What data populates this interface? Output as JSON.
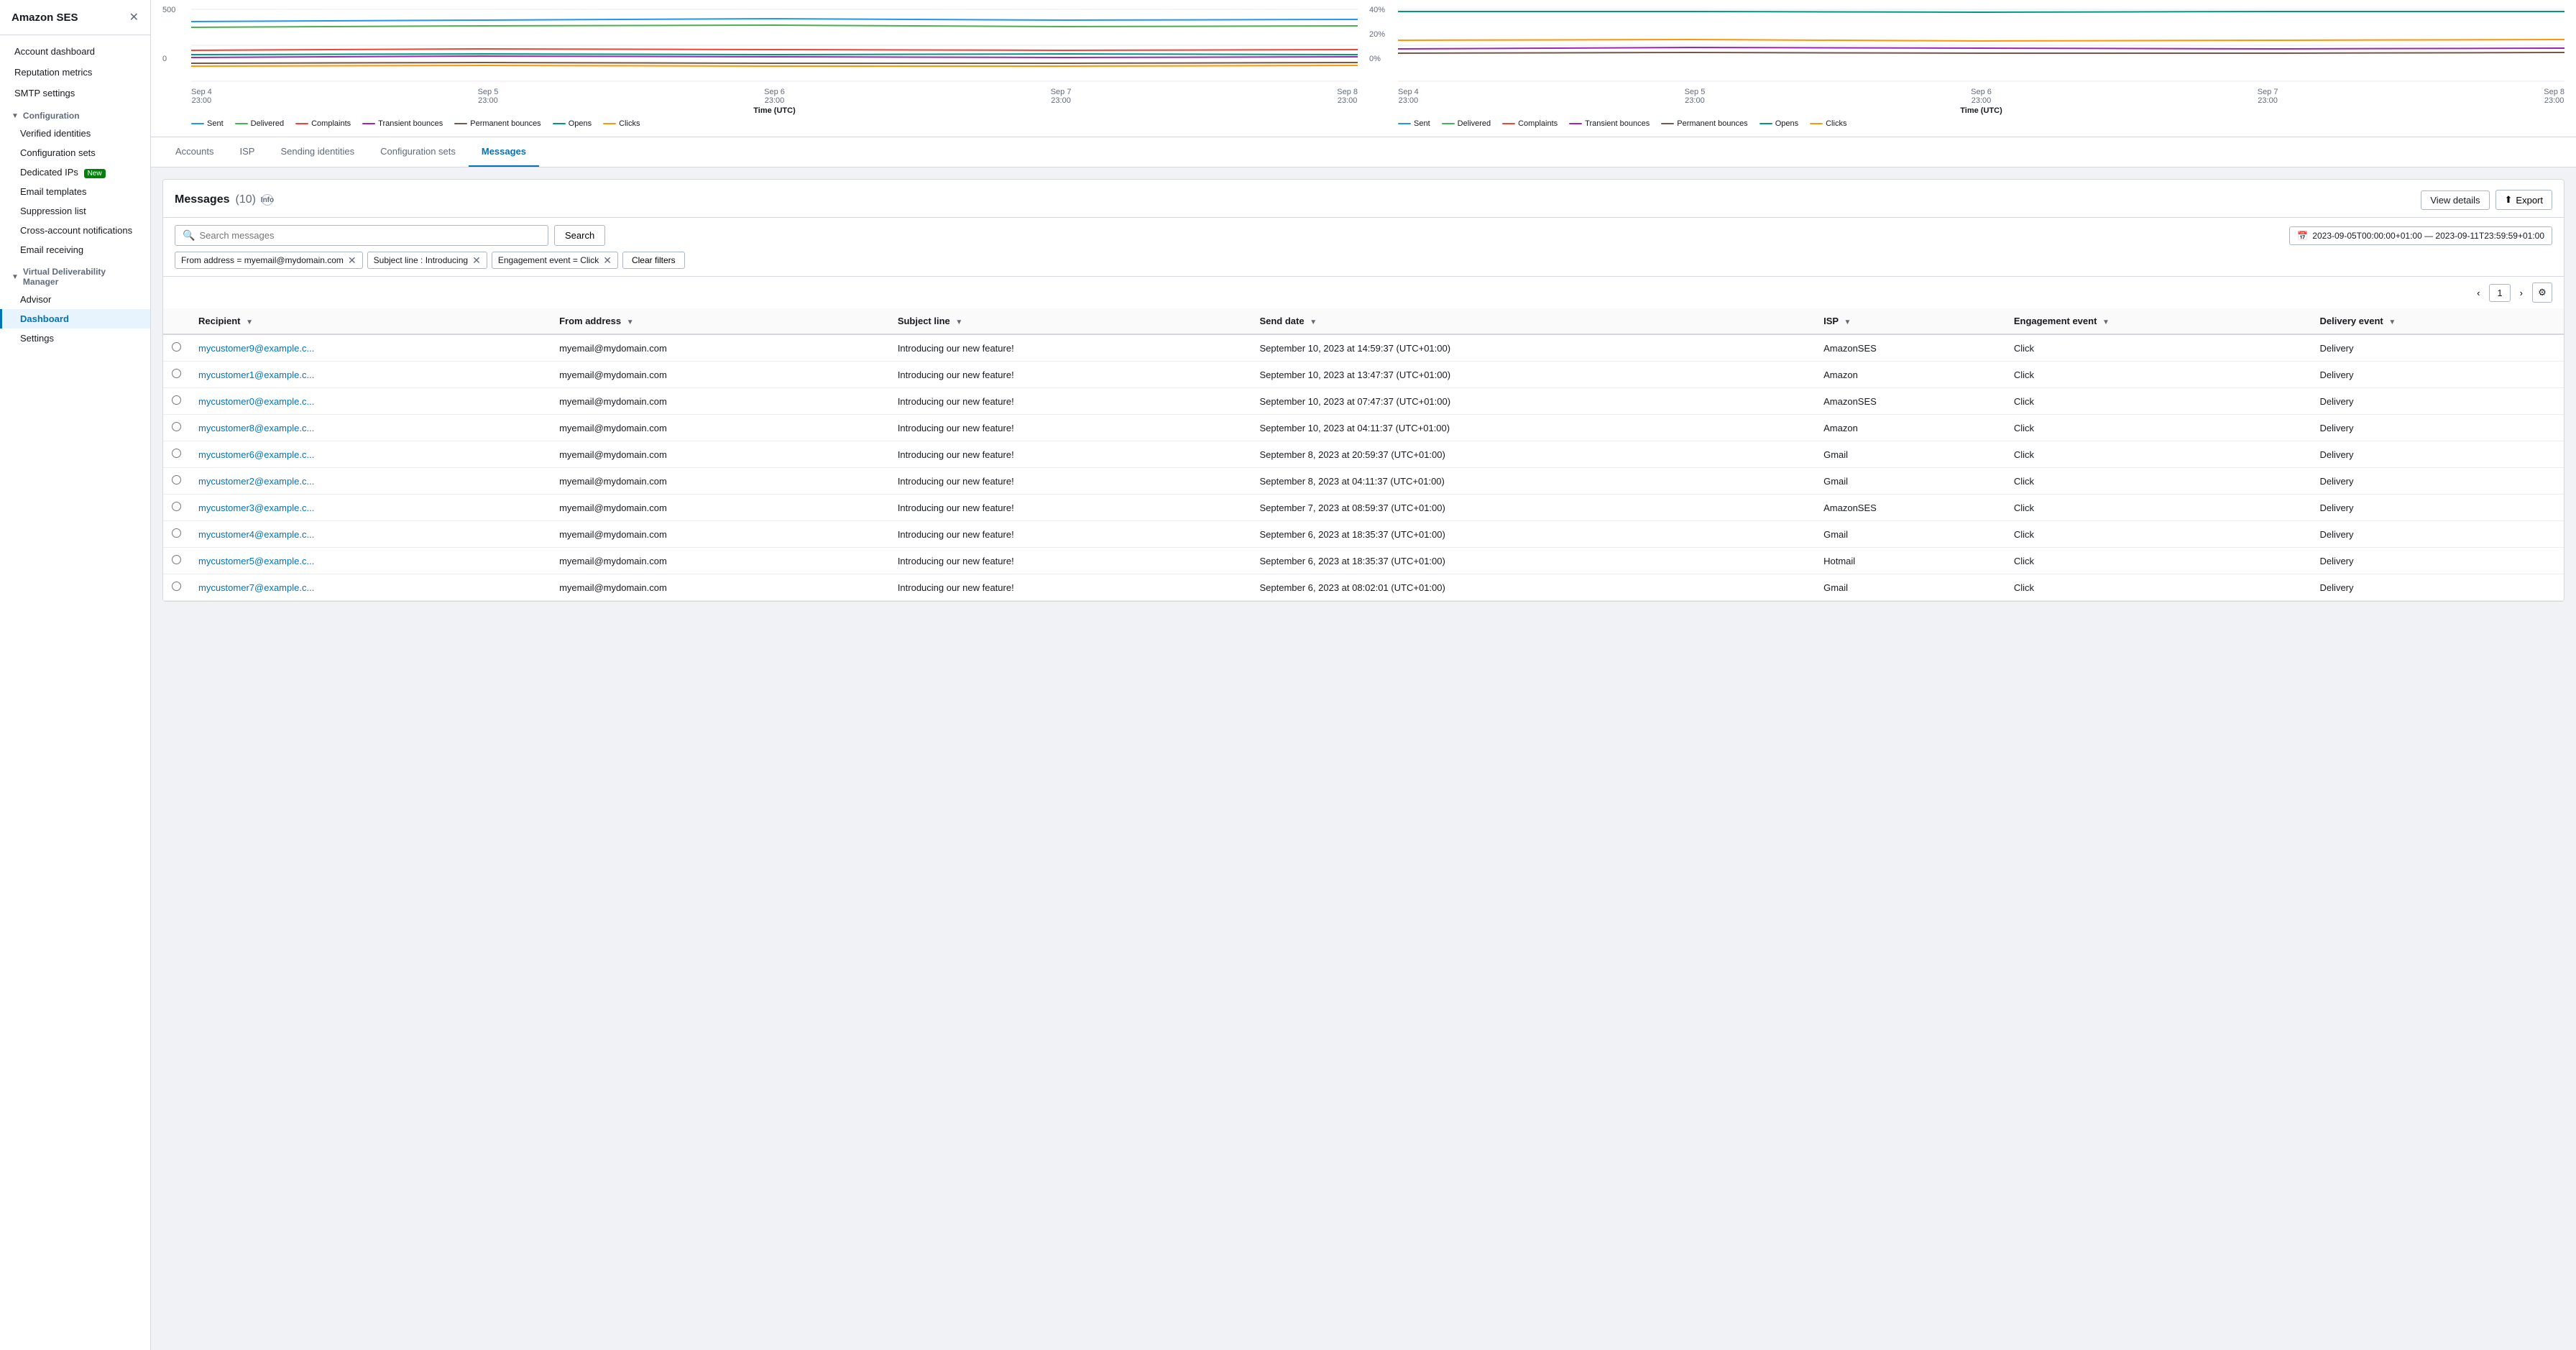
{
  "app": {
    "title": "Amazon SES",
    "close_icon": "✕"
  },
  "sidebar": {
    "nav_items": [
      {
        "id": "account-dashboard",
        "label": "Account dashboard",
        "type": "item"
      },
      {
        "id": "reputation-metrics",
        "label": "Reputation metrics",
        "type": "item"
      },
      {
        "id": "smtp-settings",
        "label": "SMTP settings",
        "type": "item"
      }
    ],
    "sections": [
      {
        "id": "configuration",
        "label": "Configuration",
        "arrow": "▼",
        "children": [
          {
            "id": "verified-identities",
            "label": "Verified identities"
          },
          {
            "id": "configuration-sets",
            "label": "Configuration sets"
          },
          {
            "id": "dedicated-ips",
            "label": "Dedicated IPs",
            "badge": "New"
          },
          {
            "id": "email-templates",
            "label": "Email templates"
          },
          {
            "id": "suppression-list",
            "label": "Suppression list"
          },
          {
            "id": "cross-account",
            "label": "Cross-account notifications"
          },
          {
            "id": "email-receiving",
            "label": "Email receiving"
          }
        ]
      },
      {
        "id": "vdm",
        "label": "Virtual Deliverability Manager",
        "arrow": "▼",
        "children": [
          {
            "id": "advisor",
            "label": "Advisor"
          },
          {
            "id": "dashboard",
            "label": "Dashboard",
            "active": true
          },
          {
            "id": "settings",
            "label": "Settings"
          }
        ]
      }
    ]
  },
  "charts": {
    "left": {
      "y_labels": [
        "500",
        "",
        "0"
      ],
      "x_labels": [
        {
          "date": "Sep 4",
          "time": "23:00"
        },
        {
          "date": "Sep 5",
          "time": "23:00"
        },
        {
          "date": "Sep 6",
          "time": "23:00"
        },
        {
          "date": "Sep 7",
          "time": "23:00"
        },
        {
          "date": "Sep 8",
          "time": "23:00"
        }
      ],
      "x_title": "Time (UTC)",
      "legend": [
        {
          "label": "Sent",
          "color": "#2196f3"
        },
        {
          "label": "Delivered",
          "color": "#4caf50"
        },
        {
          "label": "Complaints",
          "color": "#f44336"
        },
        {
          "label": "Transient bounces",
          "color": "#9c27b0"
        },
        {
          "label": "Permanent bounces",
          "color": "#795548"
        },
        {
          "label": "Opens",
          "color": "#009688"
        },
        {
          "label": "Clicks",
          "color": "#ff9800"
        }
      ]
    },
    "right": {
      "y_labels": [
        "40%",
        "20%",
        "0%"
      ],
      "x_labels": [
        {
          "date": "Sep 4",
          "time": "23:00"
        },
        {
          "date": "Sep 5",
          "time": "23:00"
        },
        {
          "date": "Sep 6",
          "time": "23:00"
        },
        {
          "date": "Sep 7",
          "time": "23:00"
        },
        {
          "date": "Sep 8",
          "time": "23:00"
        }
      ],
      "x_title": "Time (UTC)",
      "legend": [
        {
          "label": "Sent",
          "color": "#2196f3"
        },
        {
          "label": "Delivered",
          "color": "#4caf50"
        },
        {
          "label": "Complaints",
          "color": "#f44336"
        },
        {
          "label": "Transient bounces",
          "color": "#9c27b0"
        },
        {
          "label": "Permanent bounces",
          "color": "#795548"
        },
        {
          "label": "Opens",
          "color": "#009688"
        },
        {
          "label": "Clicks",
          "color": "#ff9800"
        }
      ]
    }
  },
  "tabs": [
    {
      "id": "accounts",
      "label": "Accounts"
    },
    {
      "id": "isp",
      "label": "ISP"
    },
    {
      "id": "sending-identities",
      "label": "Sending identities"
    },
    {
      "id": "configuration-sets",
      "label": "Configuration sets"
    },
    {
      "id": "messages",
      "label": "Messages",
      "active": true
    }
  ],
  "messages": {
    "title": "Messages",
    "count": "(10)",
    "info_label": "Info",
    "view_details_label": "View details",
    "export_label": "Export",
    "export_icon": "⬆",
    "search_placeholder": "Search messages",
    "search_label": "Search",
    "date_range": "2023-09-05T00:00:00+01:00 — 2023-09-11T23:59:59+01:00",
    "calendar_icon": "📅",
    "filters": [
      {
        "id": "from-address",
        "label": "From address = myemail@mydomain.com"
      },
      {
        "id": "subject-line",
        "label": "Subject line : Introducing"
      },
      {
        "id": "engagement-event",
        "label": "Engagement event = Click"
      }
    ],
    "clear_filters_label": "Clear filters",
    "page_current": "1",
    "columns": [
      {
        "id": "select",
        "label": ""
      },
      {
        "id": "recipient",
        "label": "Recipient"
      },
      {
        "id": "from-address",
        "label": "From address"
      },
      {
        "id": "subject-line",
        "label": "Subject line"
      },
      {
        "id": "send-date",
        "label": "Send date"
      },
      {
        "id": "isp",
        "label": "ISP"
      },
      {
        "id": "engagement-event",
        "label": "Engagement event"
      },
      {
        "id": "delivery-event",
        "label": "Delivery event"
      }
    ],
    "rows": [
      {
        "recipient": "mycustomer9@example.c...",
        "from_address": "myemail@mydomain.com",
        "subject_line": "Introducing our new feature!",
        "send_date": "September 10, 2023 at 14:59:37 (UTC+01:00)",
        "isp": "AmazonSES",
        "engagement_event": "Click",
        "delivery_event": "Delivery"
      },
      {
        "recipient": "mycustomer1@example.c...",
        "from_address": "myemail@mydomain.com",
        "subject_line": "Introducing our new feature!",
        "send_date": "September 10, 2023 at 13:47:37 (UTC+01:00)",
        "isp": "Amazon",
        "engagement_event": "Click",
        "delivery_event": "Delivery"
      },
      {
        "recipient": "mycustomer0@example.c...",
        "from_address": "myemail@mydomain.com",
        "subject_line": "Introducing our new feature!",
        "send_date": "September 10, 2023 at 07:47:37 (UTC+01:00)",
        "isp": "AmazonSES",
        "engagement_event": "Click",
        "delivery_event": "Delivery"
      },
      {
        "recipient": "mycustomer8@example.c...",
        "from_address": "myemail@mydomain.com",
        "subject_line": "Introducing our new feature!",
        "send_date": "September 10, 2023 at 04:11:37 (UTC+01:00)",
        "isp": "Amazon",
        "engagement_event": "Click",
        "delivery_event": "Delivery"
      },
      {
        "recipient": "mycustomer6@example.c...",
        "from_address": "myemail@mydomain.com",
        "subject_line": "Introducing our new feature!",
        "send_date": "September 8, 2023 at 20:59:37 (UTC+01:00)",
        "isp": "Gmail",
        "engagement_event": "Click",
        "delivery_event": "Delivery"
      },
      {
        "recipient": "mycustomer2@example.c...",
        "from_address": "myemail@mydomain.com",
        "subject_line": "Introducing our new feature!",
        "send_date": "September 8, 2023 at 04:11:37 (UTC+01:00)",
        "isp": "Gmail",
        "engagement_event": "Click",
        "delivery_event": "Delivery"
      },
      {
        "recipient": "mycustomer3@example.c...",
        "from_address": "myemail@mydomain.com",
        "subject_line": "Introducing our new feature!",
        "send_date": "September 7, 2023 at 08:59:37 (UTC+01:00)",
        "isp": "AmazonSES",
        "engagement_event": "Click",
        "delivery_event": "Delivery"
      },
      {
        "recipient": "mycustomer4@example.c...",
        "from_address": "myemail@mydomain.com",
        "subject_line": "Introducing our new feature!",
        "send_date": "September 6, 2023 at 18:35:37 (UTC+01:00)",
        "isp": "Gmail",
        "engagement_event": "Click",
        "delivery_event": "Delivery"
      },
      {
        "recipient": "mycustomer5@example.c...",
        "from_address": "myemail@mydomain.com",
        "subject_line": "Introducing our new feature!",
        "send_date": "September 6, 2023 at 18:35:37 (UTC+01:00)",
        "isp": "Hotmail",
        "engagement_event": "Click",
        "delivery_event": "Delivery"
      },
      {
        "recipient": "mycustomer7@example.c...",
        "from_address": "myemail@mydomain.com",
        "subject_line": "Introducing our new feature!",
        "send_date": "September 6, 2023 at 08:02:01 (UTC+01:00)",
        "isp": "Gmail",
        "engagement_event": "Click",
        "delivery_event": "Delivery"
      }
    ]
  }
}
